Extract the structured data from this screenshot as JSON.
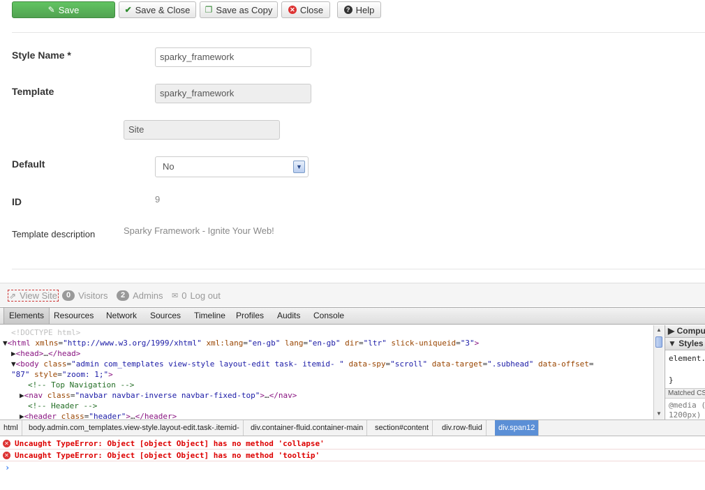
{
  "toolbar": {
    "save": "Save",
    "save_close": "Save & Close",
    "save_copy": "Save as Copy",
    "close": "Close",
    "help": "Help"
  },
  "form": {
    "style_name_label": "Style Name *",
    "style_name_value": "sparky_framework",
    "template_label": "Template",
    "template_value": "sparky_framework",
    "client_value": "Site",
    "default_label": "Default",
    "default_value": "No",
    "id_label": "ID",
    "id_value": "9",
    "description_label": "Template description",
    "description_value": "Sparky Framework - Ignite Your Web!"
  },
  "status": {
    "view_site": "View Site",
    "visitors_count": "0",
    "visitors_label": "Visitors",
    "admins_count": "2",
    "admins_label": "Admins",
    "logout_count": "0",
    "logout_label": "Log out"
  },
  "devtools": {
    "tabs": [
      "Elements",
      "Resources",
      "Network",
      "Sources",
      "Timeline",
      "Profiles",
      "Audits",
      "Console"
    ],
    "side": {
      "computed": "Computed Style",
      "styles": "Styles",
      "element_rule": "element.style {",
      "close_brace": "}",
      "matched": "Matched CSS Rules",
      "media1": "@media (min-width:",
      "media2": "1200px)"
    },
    "breadcrumbs": [
      "html",
      "body.admin.com_templates.view-style.layout-edit.task-.itemid-",
      "div.container-fluid.container-main",
      "section#content",
      "div.row-fluid",
      "div.span12"
    ],
    "errors": [
      "Uncaught TypeError: Object [object Object] has no method 'collapse'",
      "Uncaught TypeError: Object [object Object] has no method 'tooltip'"
    ],
    "prompt": "›"
  },
  "colors": {
    "save_green": "#51a351",
    "error_red": "#d00",
    "crumb_active": "#5b8fd6"
  }
}
